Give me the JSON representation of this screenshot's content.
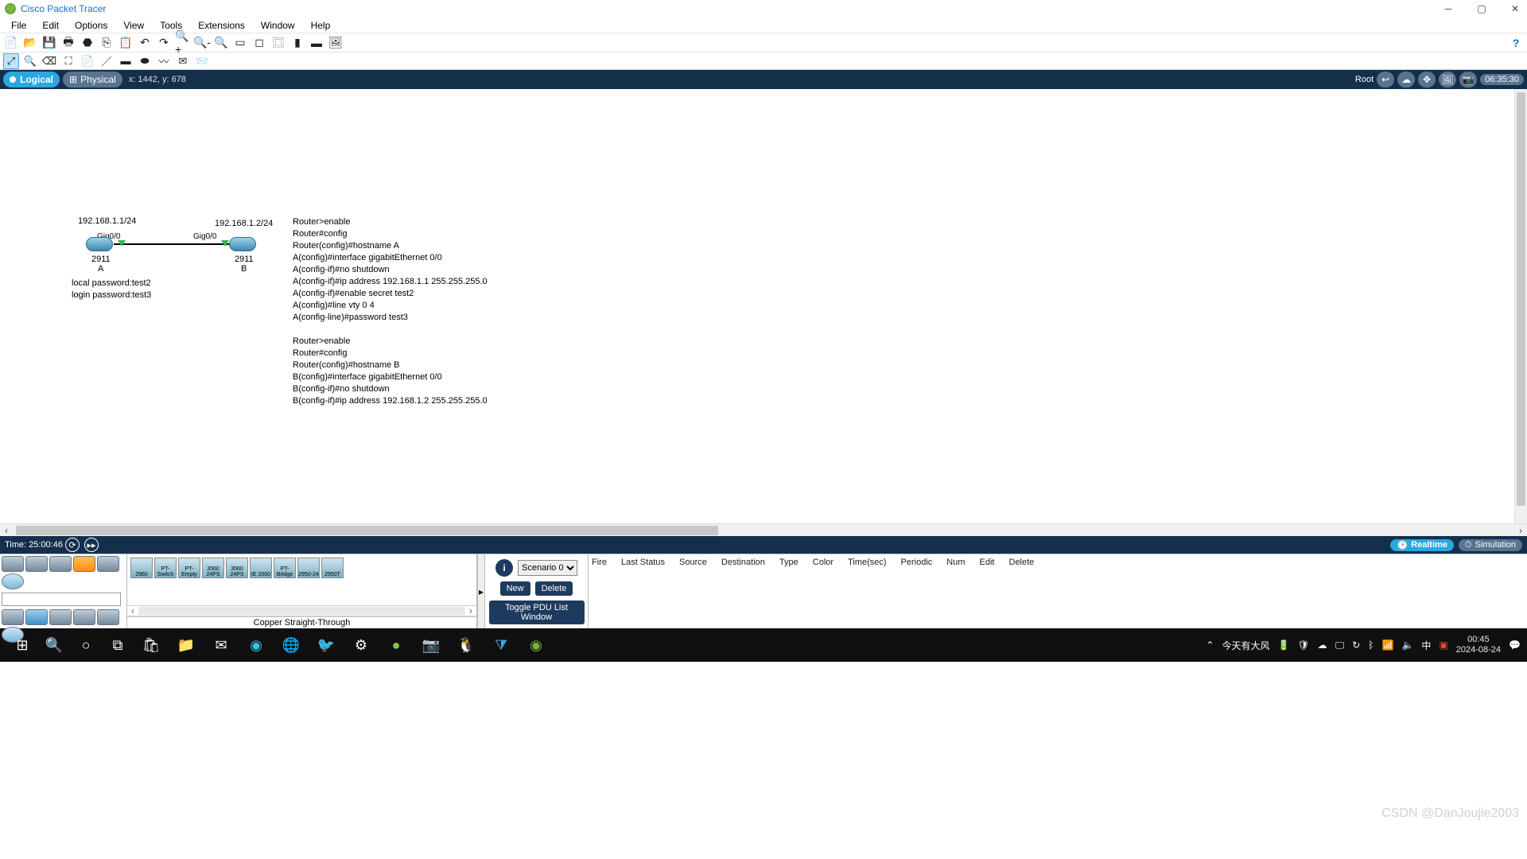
{
  "titlebar": {
    "title": "Cisco Packet Tracer"
  },
  "menu": {
    "items": [
      "File",
      "Edit",
      "Options",
      "View",
      "Tools",
      "Extensions",
      "Window",
      "Help"
    ]
  },
  "toolbar1": {
    "buttons": [
      "new-file",
      "open-folder",
      "save",
      "print",
      "activity-wizard",
      "copy",
      "paste",
      "undo",
      "redo",
      "zoom-in",
      "zoom-out",
      "zoom-reset",
      "draw-rect",
      "draw-ellipse",
      "draw-line",
      "palette-1",
      "palette-2",
      "palette-3"
    ],
    "help_icon": "?"
  },
  "toolbar2": {
    "buttons": [
      "select",
      "inspect",
      "delete",
      "resize",
      "note",
      "draw-line",
      "draw-rect",
      "draw-ellipse",
      "freeform",
      "simple-pdu",
      "complex-pdu"
    ]
  },
  "viewbar": {
    "logical": "Logical",
    "physical": "Physical",
    "coords": "x: 1442, y: 678",
    "root": "Root",
    "clock": "06:35:30"
  },
  "topology": {
    "routerA": {
      "ip": "192.168.1.1/24",
      "port": "Gig0/0",
      "model": "2911",
      "name": "A"
    },
    "routerB": {
      "ip": "192.168.1.2/24",
      "port": "Gig0/0",
      "model": "2911",
      "name": "B"
    },
    "credentials": "local password:test2\nlogin password:test3",
    "commands": "Router>enable\nRouter#config\nRouter(config)#hostname A\nA(config)#interface gigabitEthernet 0/0\nA(config-if)#no shutdown\nA(config-if)#ip address 192.168.1.1 255.255.255.0\nA(config-if)#enable secret test2\nA(config)#line vty 0 4\nA(config-line)#password test3\n\nRouter>enable\nRouter#config\nRouter(config)#hostname B\nB(config)#interface gigabitEthernet 0/0\nB(config-if)#no shutdown\nB(config-if)#ip address 192.168.1.2 255.255.255.0"
  },
  "timebar": {
    "label": "Time: 25:00:46"
  },
  "sim": {
    "realtime": "Realtime",
    "simulation": "Simulation"
  },
  "device_models": [
    "2960",
    "PT-Switch",
    "PT-Empty",
    "3560 24PS",
    "3560 24PS",
    "IE 2000",
    "PT-Bridge",
    "2950-24",
    "2950T"
  ],
  "cable_status": "Copper Straight-Through",
  "scenario": {
    "select": "Scenario 0",
    "new": "New",
    "delete": "Delete",
    "toggle": "Toggle PDU List Window"
  },
  "pdu_headers": [
    "Fire",
    "Last Status",
    "Source",
    "Destination",
    "Type",
    "Color",
    "Time(sec)",
    "Periodic",
    "Num",
    "Edit",
    "Delete"
  ],
  "taskbar": {
    "weather": "今天有大风",
    "ime": "中",
    "clock": "00:45",
    "date": "2024-08-24"
  },
  "watermark": "CSDN @DanJoujie2003"
}
